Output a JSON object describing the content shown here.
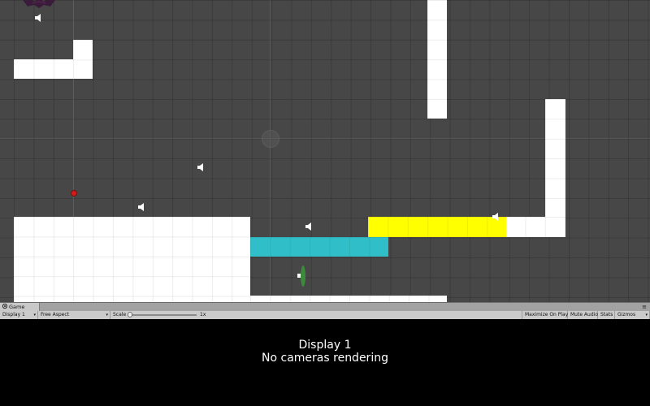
{
  "scene": {
    "colors": {
      "background": "#474747",
      "block": "#ffffff",
      "cyan_platform": "#30bfc8",
      "yellow_platform": "#ffff00",
      "marker": "#d11c1c"
    },
    "blocks": [
      "white-l-block",
      "white-pillar-top",
      "white-pillar-right",
      "white-ground-left",
      "cyan-platform",
      "yellow-platform",
      "white-ground-bottom"
    ],
    "icons": [
      "speaker-icon",
      "speaker-icon",
      "speaker-icon",
      "speaker-icon",
      "speaker-icon",
      "bat-sprite-icon",
      "player-sprite-icon",
      "red-marker-icon"
    ]
  },
  "game_panel": {
    "tab_icon": "game-controller-icon",
    "tab_label": "Game",
    "menu_icon": "≡",
    "toolbar": {
      "display": "Display 1",
      "aspect": "Free Aspect",
      "scale_label": "Scale",
      "scale_value": "1x",
      "maximize_on_play": "Maximize On Play",
      "mute_audio": "Mute Audio",
      "stats": "Stats",
      "gizmos": "Gizmos"
    },
    "view": {
      "line1": "Display 1",
      "line2": "No cameras rendering",
      "background": "#000000"
    }
  }
}
